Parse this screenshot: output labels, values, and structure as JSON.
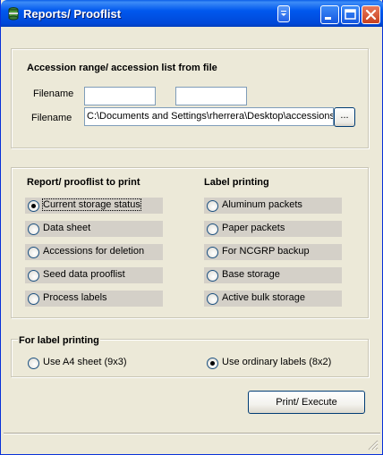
{
  "window": {
    "title": "Reports/ Prooflist",
    "colors": {
      "titlebar": "#0058ee",
      "body": "#ece9d8",
      "close_button": "#c8401f"
    },
    "icons": [
      "app-icon",
      "dropdown-menu-icon",
      "minimize-icon",
      "maximize-icon",
      "close-icon"
    ]
  },
  "accession": {
    "heading": "Accession  range/ accession list from file",
    "filename_label_1": "Filename",
    "range_from": "",
    "range_to": "",
    "filename_label_2": "Filename",
    "file_path": "C:\\Documents and Settings\\rherrera\\Desktop\\accessions",
    "browse_label": "..."
  },
  "reports": {
    "heading": "Report/ prooflist to print",
    "options": [
      {
        "label": "Current storage status",
        "checked": true
      },
      {
        "label": "Data sheet",
        "checked": false
      },
      {
        "label": "Accessions for deletion",
        "checked": false
      },
      {
        "label": "Seed data prooflist",
        "checked": false
      },
      {
        "label": "Process labels",
        "checked": false
      }
    ]
  },
  "labels": {
    "heading": "Label printing",
    "options": [
      {
        "label": "Aluminum  packets",
        "checked": false
      },
      {
        "label": "Paper packets",
        "checked": false
      },
      {
        "label": "For NCGRP backup",
        "checked": false
      },
      {
        "label": "Base storage",
        "checked": false
      },
      {
        "label": "Active bulk storage",
        "checked": false
      }
    ]
  },
  "label_format": {
    "heading": "For label printing",
    "a4_label": "Use A4 sheet (9x3)",
    "a4_checked": false,
    "ordinary_label": "Use ordinary labels (8x2)",
    "ordinary_checked": true
  },
  "actions": {
    "execute_label": "Print/ Execute"
  }
}
